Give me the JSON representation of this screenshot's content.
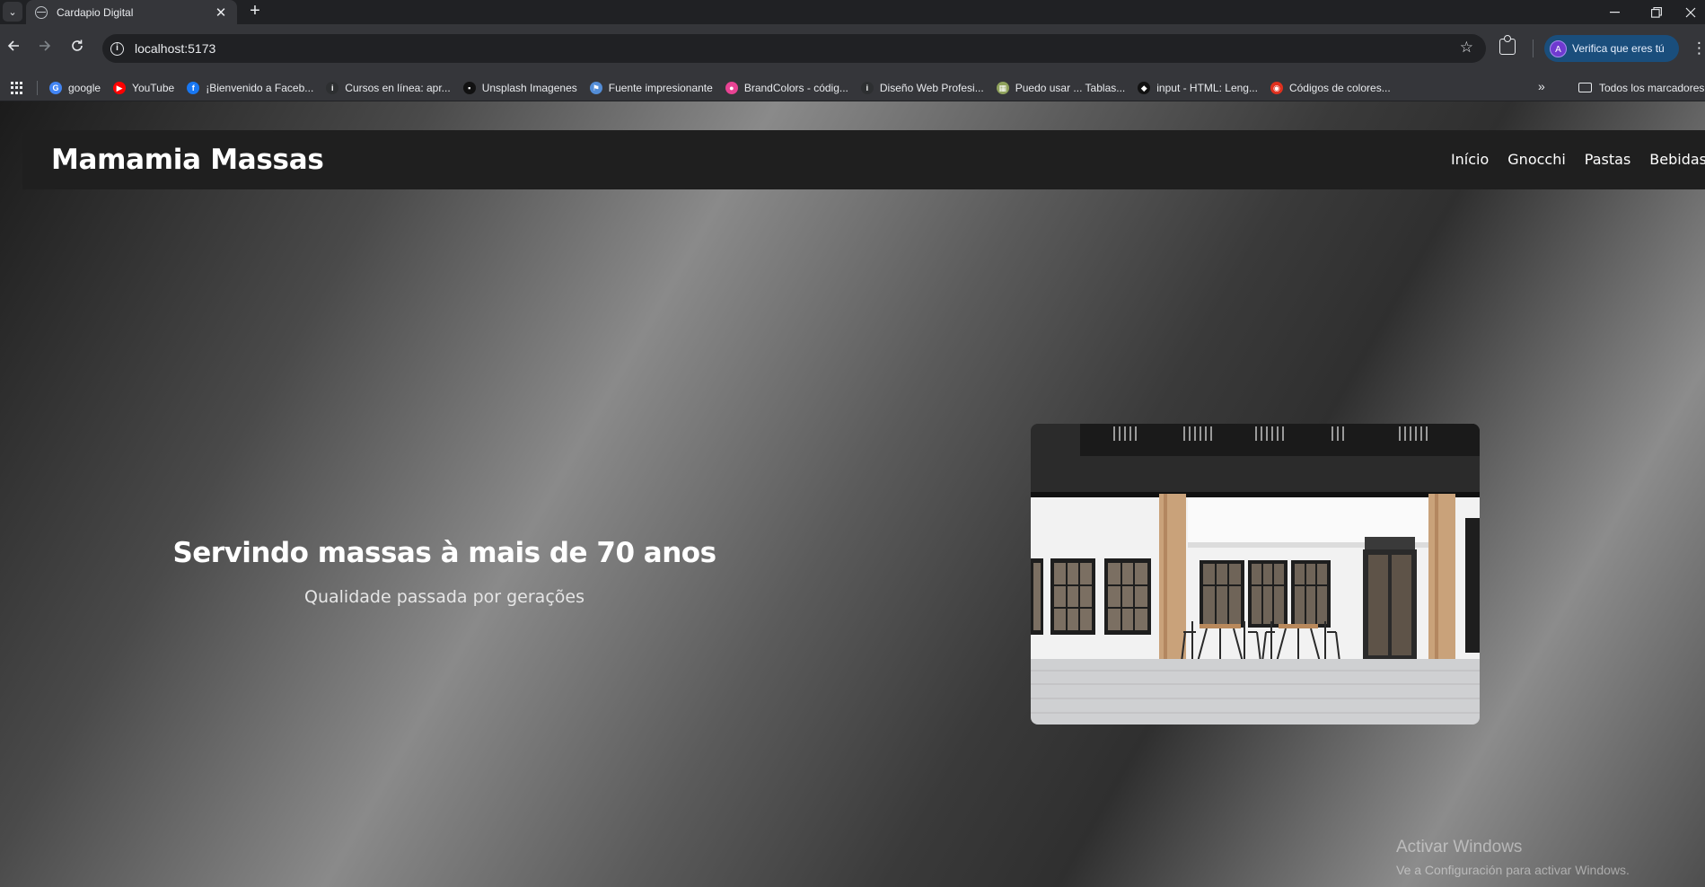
{
  "browser": {
    "tab": {
      "title": "Cardapio Digital",
      "close_glyph": "✕"
    },
    "new_tab_glyph": "+",
    "url": "localhost:5173",
    "profile_label": "Verifica que eres tú",
    "profile_initial": "A",
    "bookmarks": [
      {
        "label": "google",
        "icon": "google-icon",
        "color": "#4285f4",
        "glyph": "G"
      },
      {
        "label": "YouTube",
        "icon": "youtube-icon",
        "color": "#ff0000",
        "glyph": "▶"
      },
      {
        "label": "¡Bienvenido a Faceb...",
        "icon": "facebook-icon",
        "color": "#1877f2",
        "glyph": "f"
      },
      {
        "label": "Cursos en línea: apr...",
        "icon": "udemy-icon",
        "color": "#2d2f31",
        "glyph": "i"
      },
      {
        "label": "Unsplash Imagenes",
        "icon": "unsplash-icon",
        "color": "#111111",
        "glyph": "▪"
      },
      {
        "label": "Fuente impresionante",
        "icon": "fontawesome-icon",
        "color": "#538dd7",
        "glyph": "⚑"
      },
      {
        "label": "BrandColors - códig...",
        "icon": "brandcolors-icon",
        "color": "#e84393",
        "glyph": "●"
      },
      {
        "label": "Diseño Web Profesi...",
        "icon": "udemy-icon",
        "color": "#2d2f31",
        "glyph": "i"
      },
      {
        "label": "Puedo usar ... Tablas...",
        "icon": "caniuse-icon",
        "color": "#8fa25c",
        "glyph": "▦"
      },
      {
        "label": "input - HTML: Leng...",
        "icon": "mdn-icon",
        "color": "#111111",
        "glyph": "◆"
      },
      {
        "label": "Códigos de colores...",
        "icon": "color-codes-icon",
        "color": "#e0301e",
        "glyph": "◉"
      }
    ],
    "all_bookmarks_label": "Todos los marcadores"
  },
  "site": {
    "brand": "Mamamia Massas",
    "nav": [
      "Início",
      "Gnocchi",
      "Pastas",
      "Bebidas"
    ],
    "hero_title": "Servindo massas à mais de 70 anos",
    "hero_subtitle": "Qualidade passada por gerações"
  },
  "watermark": {
    "title": "Activar Windows",
    "subtitle": "Ve a Configuración para activar Windows."
  }
}
